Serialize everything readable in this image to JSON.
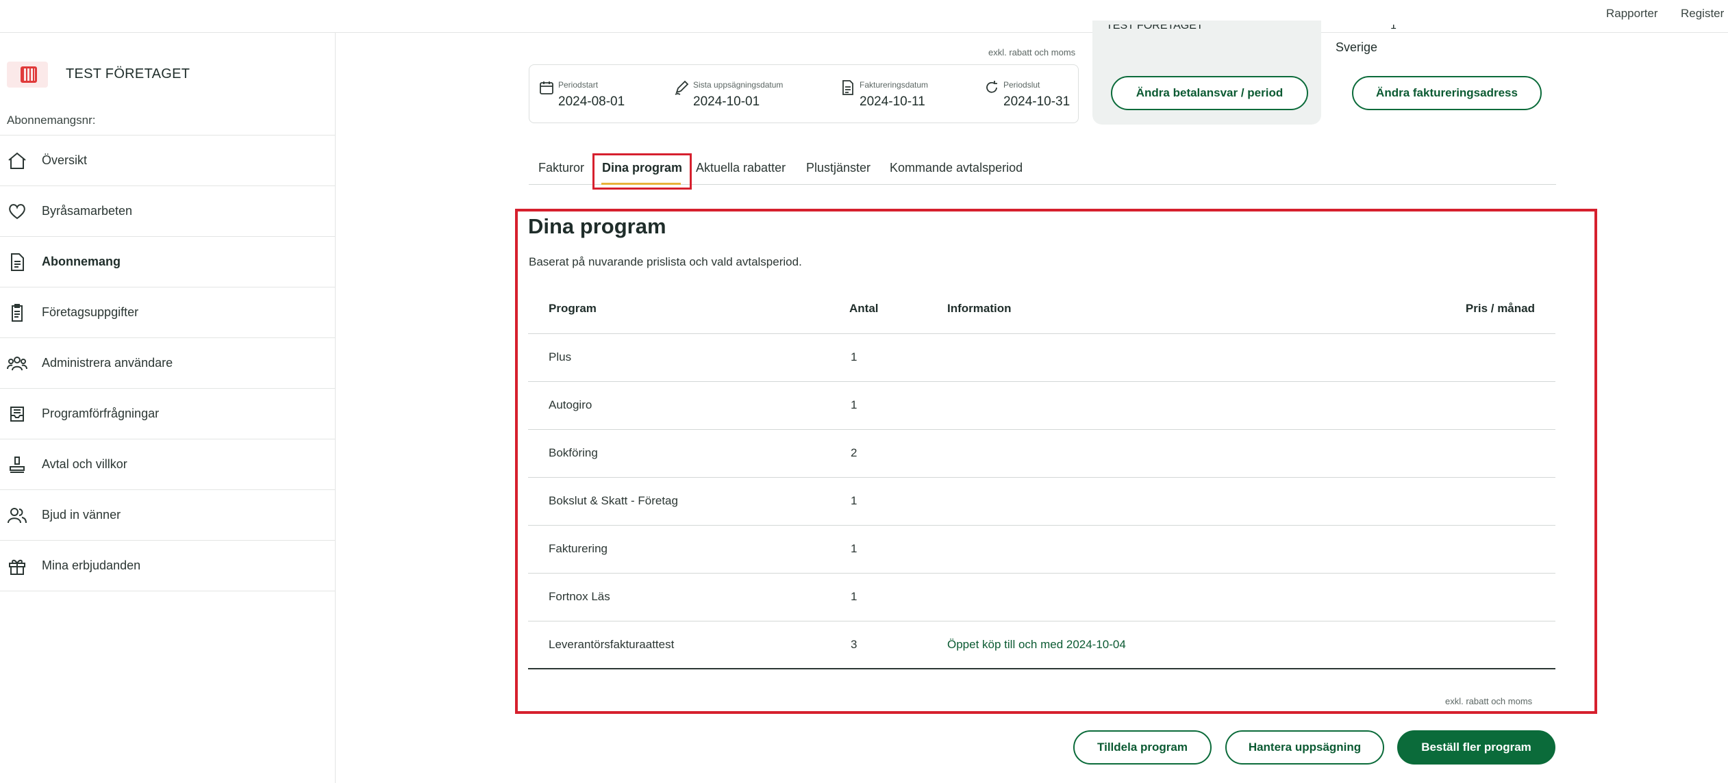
{
  "topbar": {
    "links": [
      "Rapporter",
      "Register"
    ]
  },
  "sidebar": {
    "company_name": "TEST FÖRETAGET",
    "subscription_label": "Abonnemangsnr:",
    "items": [
      {
        "label": "Översikt",
        "icon": "home-icon",
        "active": false
      },
      {
        "label": "Byråsamarbeten",
        "icon": "heart-icon",
        "active": false
      },
      {
        "label": "Abonnemang",
        "icon": "document-icon",
        "active": true
      },
      {
        "label": "Företagsuppgifter",
        "icon": "clipboard-icon",
        "active": false
      },
      {
        "label": "Administrera användare",
        "icon": "users-icon",
        "active": false
      },
      {
        "label": "Programförfrågningar",
        "icon": "inbox-icon",
        "active": false
      },
      {
        "label": "Avtal och villkor",
        "icon": "stamp-icon",
        "active": false
      },
      {
        "label": "Bjud in vänner",
        "icon": "friends-icon",
        "active": false
      },
      {
        "label": "Mina erbjudanden",
        "icon": "gift-icon",
        "active": false
      }
    ]
  },
  "header": {
    "excl_note": "exkl. rabatt och moms",
    "periods": [
      {
        "label": "Periodstart",
        "value": "2024-08-01",
        "icon": "calendar-icon"
      },
      {
        "label": "Sista uppsägningsdatum",
        "value": "2024-10-01",
        "icon": "pen-icon"
      },
      {
        "label": "Faktureringsdatum",
        "value": "2024-10-11",
        "icon": "invoice-icon"
      },
      {
        "label": "Periodslut",
        "value": "2024-10-31",
        "icon": "refresh-icon"
      }
    ],
    "payer_name_cut": "TEST FÖRETAGET",
    "address_cut": "1",
    "country": "Sverige",
    "change_payer_button": "Ändra betalansvar / period",
    "change_address_button": "Ändra faktureringsadress"
  },
  "tabs": [
    {
      "label": "Fakturor",
      "active": false
    },
    {
      "label": "Dina program",
      "active": true
    },
    {
      "label": "Aktuella rabatter",
      "active": false
    },
    {
      "label": "Plustjänster",
      "active": false
    },
    {
      "label": "Kommande avtalsperiod",
      "active": false
    }
  ],
  "programs": {
    "title": "Dina program",
    "subtitle": "Baserat på nuvarande prislista och vald avtalsperiod.",
    "columns": [
      "Program",
      "Antal",
      "Information",
      "Pris / månad"
    ],
    "rows": [
      {
        "program": "Plus",
        "antal": "1",
        "info": ""
      },
      {
        "program": "Autogiro",
        "antal": "1",
        "info": ""
      },
      {
        "program": "Bokföring",
        "antal": "2",
        "info": ""
      },
      {
        "program": "Bokslut & Skatt - Företag",
        "antal": "1",
        "info": ""
      },
      {
        "program": "Fakturering",
        "antal": "1",
        "info": ""
      },
      {
        "program": "Fortnox Läs",
        "antal": "1",
        "info": ""
      },
      {
        "program": "Leverantörsfakturaattest",
        "antal": "3",
        "info": "Öppet köp till och med 2024-10-04"
      }
    ],
    "excl_note": "exkl. rabatt och moms"
  },
  "actions": {
    "assign_button": "Tilldela program",
    "cancel_button": "Hantera uppsägning",
    "order_button": "Beställ fler program"
  },
  "colors": {
    "accent": "#0b6b3a",
    "highlight": "#d6202e",
    "tab_underline": "#e8b23a"
  }
}
